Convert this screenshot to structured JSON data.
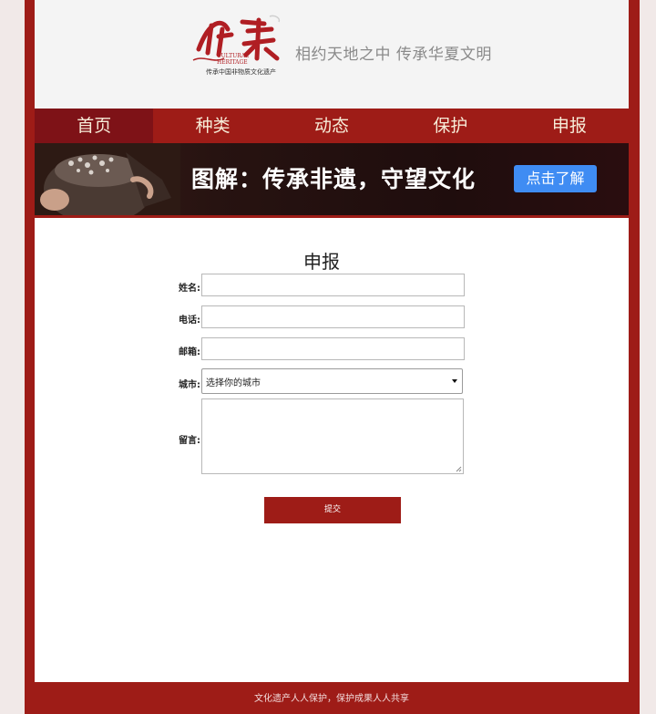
{
  "header": {
    "logo_main": "传承",
    "logo_en_line1": "CULTURAL",
    "logo_en_line2": "HERITAGE",
    "logo_sub": "传承中国非物质文化遗产",
    "slogan": "相约天地之中  传承华夏文明"
  },
  "nav": {
    "items": [
      "首页",
      "种类",
      "动态",
      "保护",
      "申报"
    ],
    "active_index": 0
  },
  "banner": {
    "title": "图解：传承非遗，守望文化",
    "button_label": "点击了解"
  },
  "form": {
    "title": "申报",
    "name_label": "姓名:",
    "phone_label": "电话:",
    "email_label": "邮箱:",
    "city_label": "城市:",
    "city_selected": "选择你的城市",
    "message_label": "留言:",
    "submit_label": "提交"
  },
  "footer": {
    "text": "文化遗产人人保护，保护成果人人共享"
  },
  "colors": {
    "brand_red": "#9e1c17",
    "nav_active": "#7e1217",
    "banner_button": "#3f8cf3",
    "page_bg": "#f1e9e8"
  }
}
